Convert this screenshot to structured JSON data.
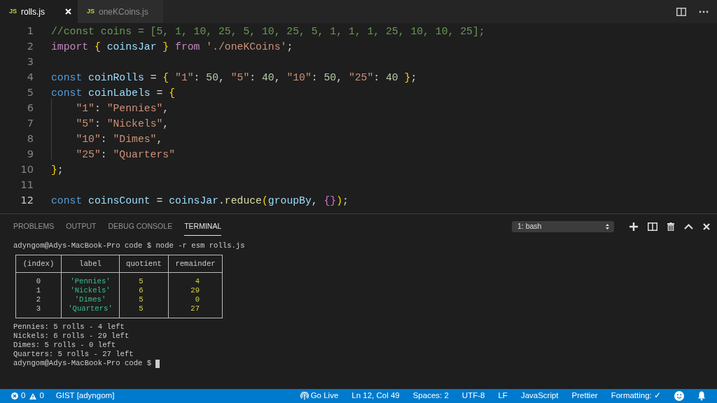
{
  "tabs": [
    {
      "badge": "JS",
      "label": "rolls.js",
      "selected": true
    },
    {
      "badge": "JS",
      "label": "oneKCoins.js",
      "selected": false
    }
  ],
  "editor": {
    "lines": [
      {
        "number": "1",
        "current": false,
        "tokens": [
          {
            "kind": "comment",
            "text": "//const coins = [5, 1, 10, 25, 5, 10, 25, 5, 1, 1, 1, 25, 10, 10, 25];"
          }
        ]
      },
      {
        "number": "2",
        "current": false,
        "tokens": [
          {
            "kind": "control",
            "text": "import "
          },
          {
            "kind": "brace",
            "text": "{ "
          },
          {
            "kind": "variable",
            "text": "coinsJar "
          },
          {
            "kind": "brace",
            "text": "} "
          },
          {
            "kind": "control",
            "text": "from "
          },
          {
            "kind": "string",
            "text": "'./oneKCoins'"
          },
          {
            "kind": "plain",
            "text": ";"
          }
        ]
      },
      {
        "number": "3",
        "current": false
      },
      {
        "number": "4",
        "current": false,
        "tokens": [
          {
            "kind": "keyword",
            "text": "const "
          },
          {
            "kind": "variable",
            "text": "coinRolls"
          },
          {
            "kind": "plain",
            "text": " = "
          },
          {
            "kind": "brace",
            "text": "{ "
          },
          {
            "kind": "string",
            "text": "\"1\""
          },
          {
            "kind": "plain",
            "text": ": "
          },
          {
            "kind": "number",
            "text": "50"
          },
          {
            "kind": "plain",
            "text": ", "
          },
          {
            "kind": "string",
            "text": "\"5\""
          },
          {
            "kind": "plain",
            "text": ": "
          },
          {
            "kind": "number",
            "text": "40"
          },
          {
            "kind": "plain",
            "text": ", "
          },
          {
            "kind": "string",
            "text": "\"10\""
          },
          {
            "kind": "plain",
            "text": ": "
          },
          {
            "kind": "number",
            "text": "50"
          },
          {
            "kind": "plain",
            "text": ", "
          },
          {
            "kind": "string",
            "text": "\"25\""
          },
          {
            "kind": "plain",
            "text": ": "
          },
          {
            "kind": "number",
            "text": "40 "
          },
          {
            "kind": "brace",
            "text": "}"
          },
          {
            "kind": "plain",
            "text": ";"
          }
        ]
      },
      {
        "number": "5",
        "current": false,
        "tokens": [
          {
            "kind": "keyword",
            "text": "const "
          },
          {
            "kind": "variable",
            "text": "coinLabels"
          },
          {
            "kind": "plain",
            "text": " = "
          },
          {
            "kind": "brace",
            "text": "{"
          }
        ]
      },
      {
        "number": "6",
        "current": false,
        "tokens": [
          {
            "kind": "string",
            "text": "    \"1\""
          },
          {
            "kind": "plain",
            "text": ": "
          },
          {
            "kind": "string",
            "text": "\"Pennies\""
          },
          {
            "kind": "plain",
            "text": ","
          }
        ]
      },
      {
        "number": "7",
        "current": false,
        "tokens": [
          {
            "kind": "string",
            "text": "    \"5\""
          },
          {
            "kind": "plain",
            "text": ": "
          },
          {
            "kind": "string",
            "text": "\"Nickels\""
          },
          {
            "kind": "plain",
            "text": ","
          }
        ]
      },
      {
        "number": "8",
        "current": false,
        "tokens": [
          {
            "kind": "string",
            "text": "    \"10\""
          },
          {
            "kind": "plain",
            "text": ": "
          },
          {
            "kind": "string",
            "text": "\"Dimes\""
          },
          {
            "kind": "plain",
            "text": ","
          }
        ]
      },
      {
        "number": "9",
        "current": false,
        "tokens": [
          {
            "kind": "string",
            "text": "    \"25\""
          },
          {
            "kind": "plain",
            "text": ": "
          },
          {
            "kind": "string",
            "text": "\"Quarters\""
          }
        ]
      },
      {
        "number": "10",
        "current": false,
        "tokens": [
          {
            "kind": "brace",
            "text": "}"
          },
          {
            "kind": "plain",
            "text": ";"
          }
        ]
      },
      {
        "number": "11",
        "current": false
      },
      {
        "number": "12",
        "current": true,
        "tokens": [
          {
            "kind": "keyword",
            "text": "const "
          },
          {
            "kind": "variable",
            "text": "coinsCount"
          },
          {
            "kind": "plain",
            "text": " = "
          },
          {
            "kind": "variable",
            "text": "coinsJar"
          },
          {
            "kind": "plain",
            "text": "."
          },
          {
            "kind": "function",
            "text": "reduce"
          },
          {
            "kind": "brace",
            "text": "("
          },
          {
            "kind": "variable",
            "text": "groupBy"
          },
          {
            "kind": "plain",
            "text": ", "
          },
          {
            "kind": "inner_brace",
            "text": "{}"
          },
          {
            "kind": "brace",
            "text": ")"
          },
          {
            "kind": "plain",
            "text": ";"
          }
        ]
      }
    ]
  },
  "panel": {
    "tabs": [
      {
        "label": "PROBLEMS",
        "selected": false
      },
      {
        "label": "OUTPUT",
        "selected": false
      },
      {
        "label": "DEBUG CONSOLE",
        "selected": false
      },
      {
        "label": "TERMINAL",
        "selected": true
      }
    ],
    "terminal_picker": "1: bash",
    "terminal": [
      {
        "kind": "text",
        "text": "adyngom@Adys-MacBook-Pro code $ node -r esm rolls.js"
      },
      {
        "kind": "table",
        "columns": [
          "(index)",
          "label",
          "quotient",
          "remainder"
        ],
        "rows": [
          [
            "0",
            "'Pennies'",
            "5",
            "4"
          ],
          [
            "1",
            "'Nickels'",
            "6",
            "29"
          ],
          [
            "2",
            "'Dimes'",
            "5",
            "0"
          ],
          [
            "3",
            "'Quarters'",
            "5",
            "27"
          ]
        ]
      },
      {
        "kind": "text",
        "text": "Pennies: 5 rolls - 4 left"
      },
      {
        "kind": "text",
        "text": "Nickels: 6 rolls - 29 left"
      },
      {
        "kind": "text",
        "text": "Dimes: 5 rolls - 0 left"
      },
      {
        "kind": "text",
        "text": "Quarters: 5 rolls - 27 left"
      },
      {
        "kind": "prompt",
        "text": "adyngom@Adys-MacBook-Pro code $"
      }
    ]
  },
  "status_bar": {
    "errors": "0",
    "warnings": "0",
    "left": [
      "GIST [adyngom]"
    ],
    "right": [
      {
        "kind": "live",
        "text": "Go Live"
      },
      {
        "kind": "text",
        "text": "Ln 12, Col 49"
      },
      {
        "kind": "text",
        "text": "Spaces: 2"
      },
      {
        "kind": "text",
        "text": "UTF-8"
      },
      {
        "kind": "text",
        "text": "LF"
      },
      {
        "kind": "text",
        "text": "JavaScript"
      },
      {
        "kind": "text",
        "text": "Prettier"
      },
      {
        "kind": "text",
        "text": "Formatting: ✓"
      },
      {
        "kind": "smiley"
      },
      {
        "kind": "bell"
      }
    ]
  }
}
